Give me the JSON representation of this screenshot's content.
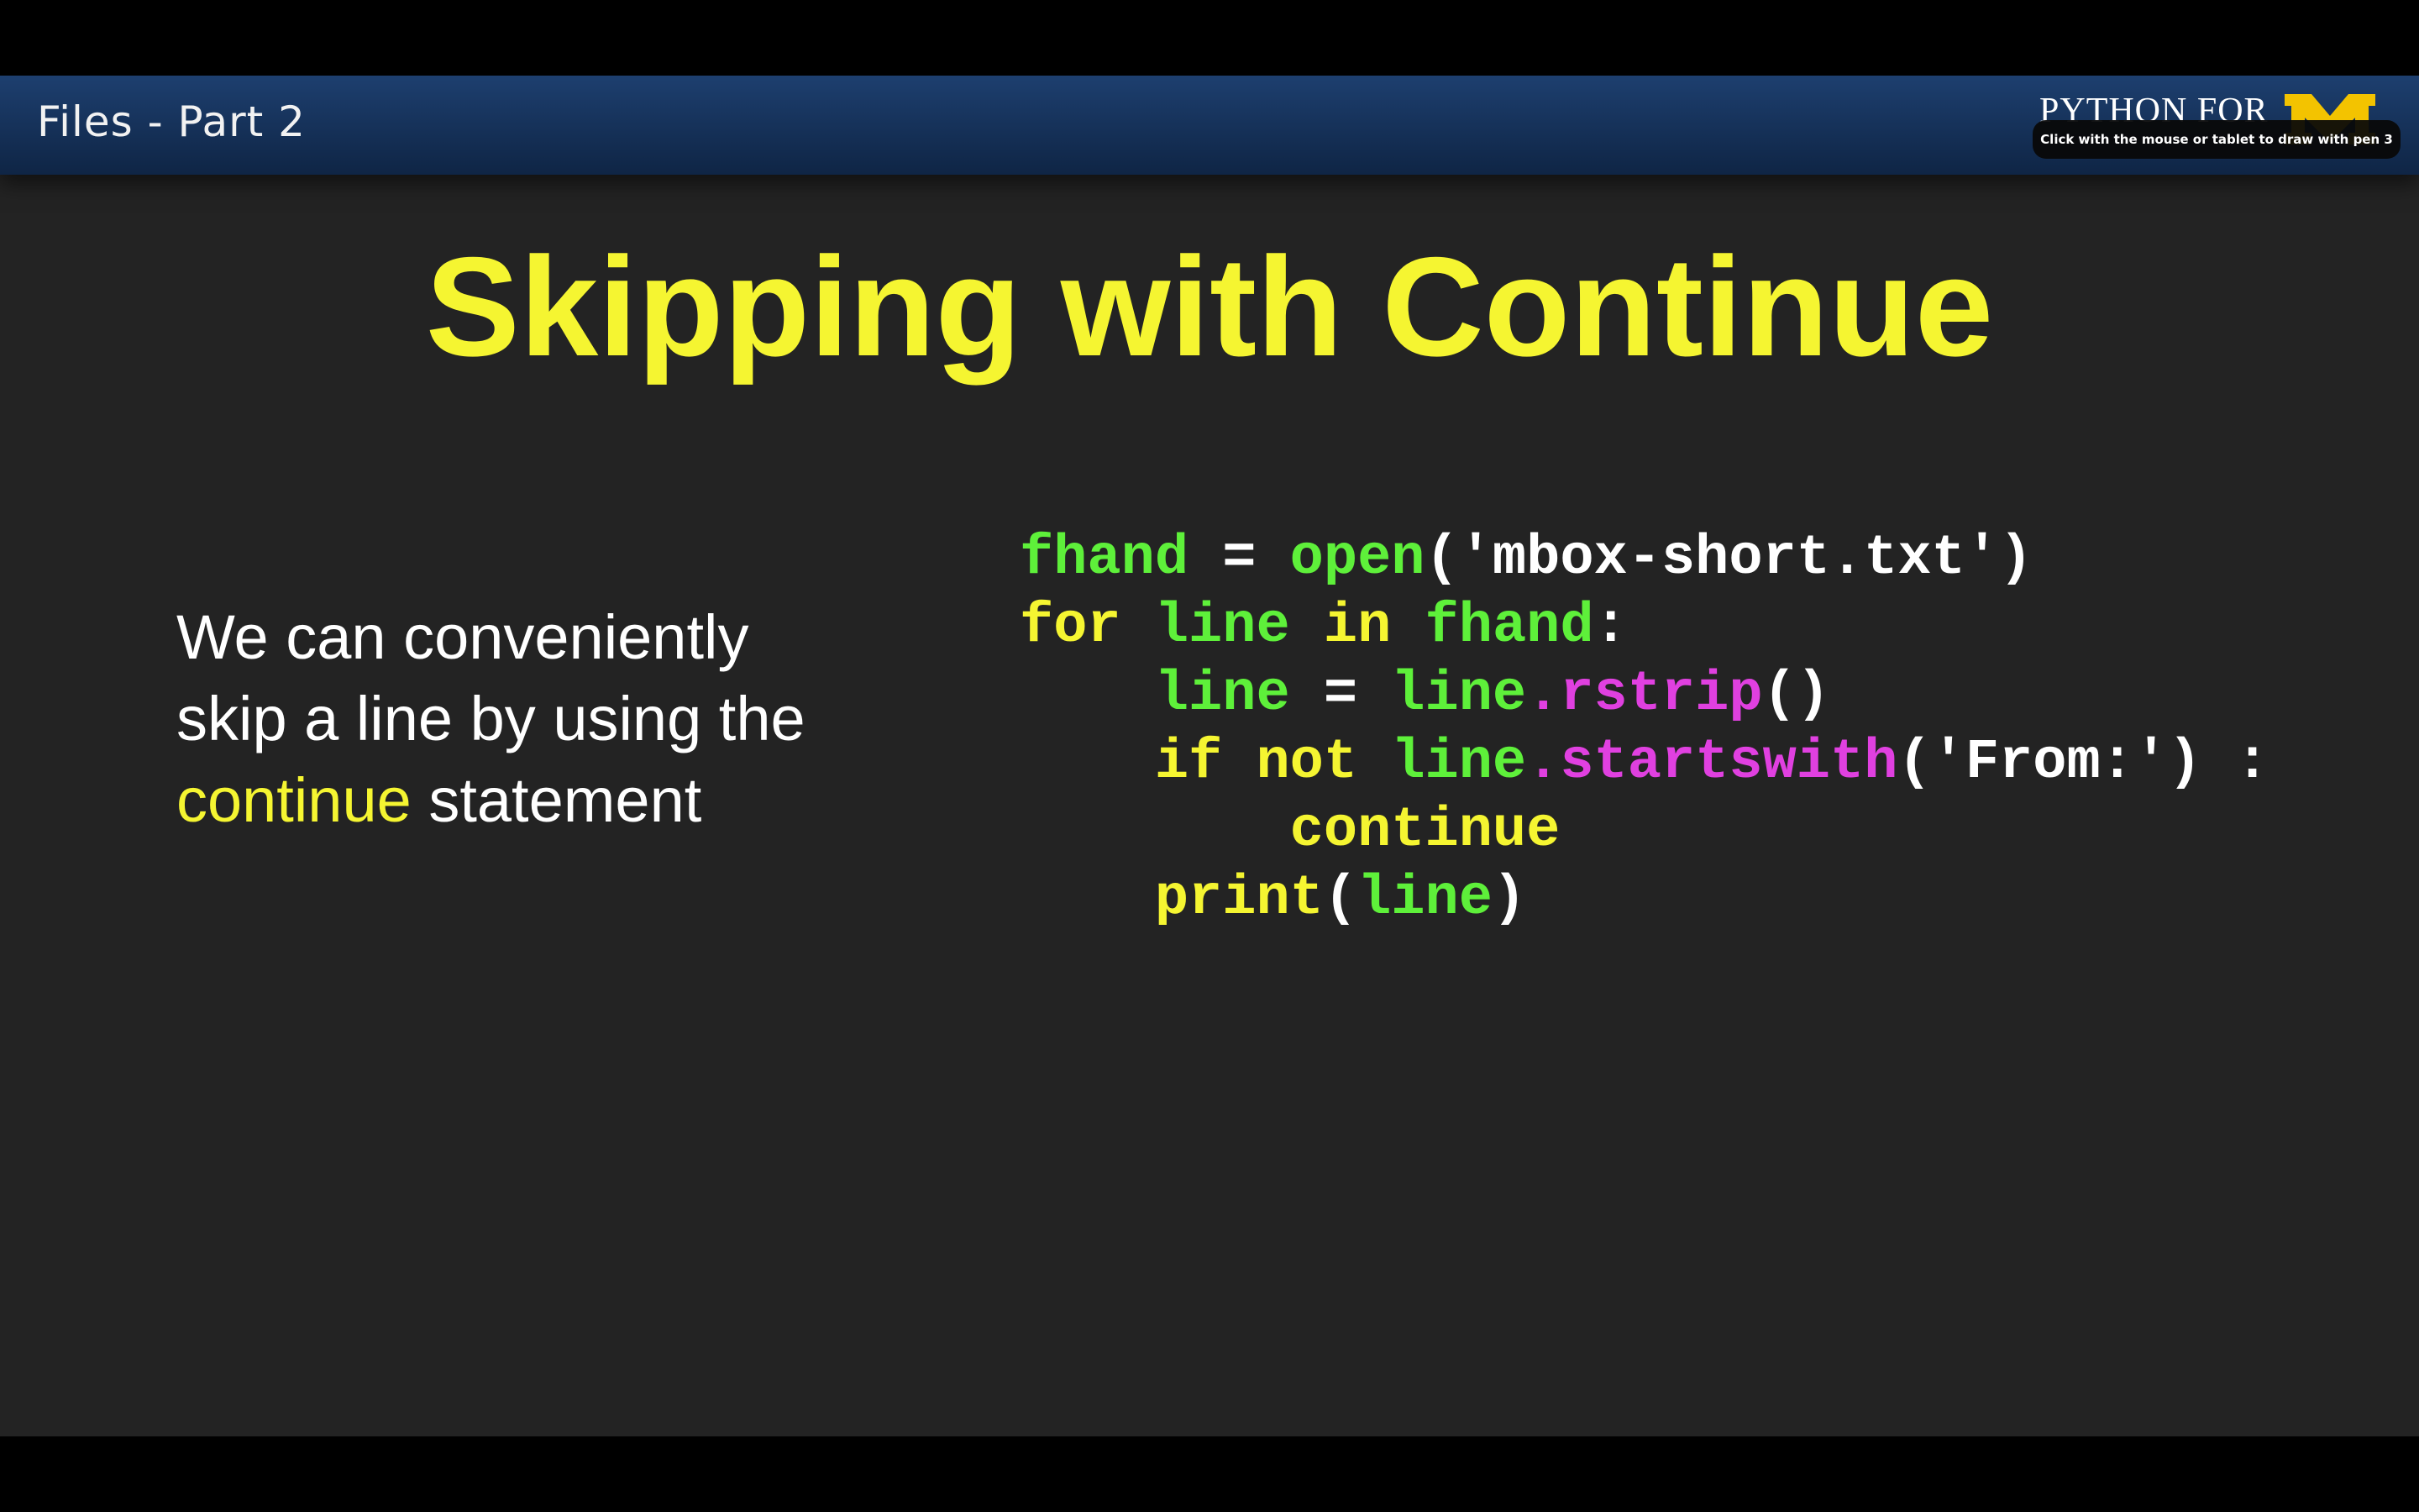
{
  "header": {
    "title": "Files - Part 2",
    "brand_text": "PYTHON FOR",
    "logo_letter": "M",
    "tooltip": "Click with the mouse or tablet to draw with pen 3"
  },
  "slide": {
    "title": "Skipping with Continue",
    "body_line1": "We can conveniently",
    "body_line2": "skip a line by using the",
    "body_keyword": "continue",
    "body_after": " statement"
  },
  "code": {
    "lines": [
      [
        {
          "t": "fhand",
          "k": "var"
        },
        {
          "t": " = ",
          "k": "plain"
        },
        {
          "t": "open",
          "k": "var"
        },
        {
          "t": "('mbox-short.txt')",
          "k": "plain"
        }
      ],
      [
        {
          "t": "for",
          "k": "kw"
        },
        {
          "t": " ",
          "k": "plain"
        },
        {
          "t": "line",
          "k": "var"
        },
        {
          "t": " ",
          "k": "plain"
        },
        {
          "t": "in",
          "k": "kw"
        },
        {
          "t": " ",
          "k": "plain"
        },
        {
          "t": "fhand",
          "k": "var"
        },
        {
          "t": ":",
          "k": "plain"
        }
      ],
      [
        {
          "t": "    ",
          "k": "plain"
        },
        {
          "t": "line",
          "k": "var"
        },
        {
          "t": " = ",
          "k": "plain"
        },
        {
          "t": "line",
          "k": "var"
        },
        {
          "t": ".rstrip",
          "k": "meth"
        },
        {
          "t": "()",
          "k": "plain"
        }
      ],
      [
        {
          "t": "    ",
          "k": "plain"
        },
        {
          "t": "if",
          "k": "kw"
        },
        {
          "t": " ",
          "k": "plain"
        },
        {
          "t": "not",
          "k": "kw"
        },
        {
          "t": " ",
          "k": "plain"
        },
        {
          "t": "line",
          "k": "var"
        },
        {
          "t": ".startswith",
          "k": "meth"
        },
        {
          "t": "('From:') :",
          "k": "plain"
        }
      ],
      [
        {
          "t": "        ",
          "k": "plain"
        },
        {
          "t": "continue",
          "k": "kw"
        }
      ],
      [
        {
          "t": "    ",
          "k": "plain"
        },
        {
          "t": "print",
          "k": "kw"
        },
        {
          "t": "(",
          "k": "plain"
        },
        {
          "t": "line",
          "k": "var"
        },
        {
          "t": ")",
          "k": "plain"
        }
      ]
    ]
  },
  "colors": {
    "keyword": "#f5f531",
    "variable": "#5ef03a",
    "method": "#e040e0",
    "header": "#1a3a68",
    "slide_bg": "#232323"
  }
}
